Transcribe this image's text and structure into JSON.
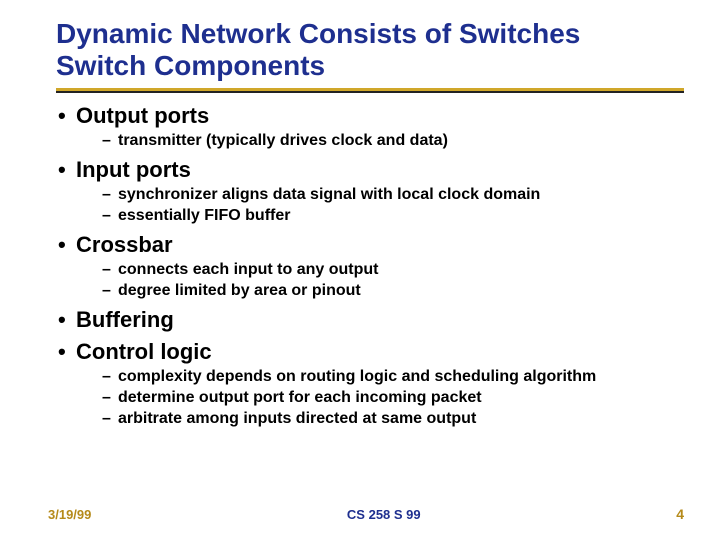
{
  "title_line1": "Dynamic Network Consists of Switches",
  "title_line2": "Switch Components",
  "bullets": {
    "b0": "Output ports",
    "b0_sub0": "transmitter (typically drives clock and data)",
    "b1": "Input ports",
    "b1_sub0": "synchronizer aligns data signal with local clock domain",
    "b1_sub1": "essentially FIFO buffer",
    "b2": "Crossbar",
    "b2_sub0": "connects each input to any output",
    "b2_sub1": "degree limited by area or pinout",
    "b3": "Buffering",
    "b4": "Control logic",
    "b4_sub0": "complexity depends on routing logic and scheduling algorithm",
    "b4_sub1": "determine output port for each incoming packet",
    "b4_sub2": "arbitrate among inputs directed at same output"
  },
  "footer": {
    "date": "3/19/99",
    "course": "CS 258 S 99",
    "page": "4"
  }
}
